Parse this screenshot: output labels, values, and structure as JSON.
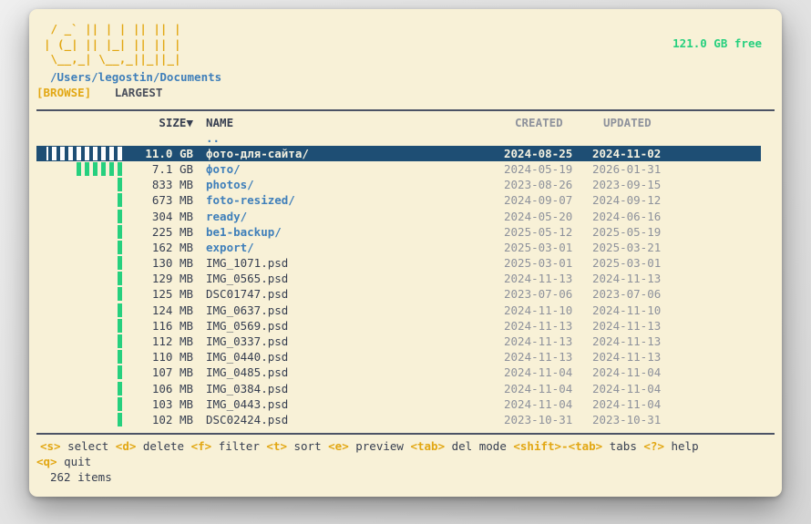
{
  "colors": {
    "window_background": "#f8f1d7",
    "accent_gold": "#e2a713",
    "directory_blue": "#3f7fba",
    "bar_green": "#26d07e",
    "selection_navy": "#1e4e74",
    "text_dark": "#373f51",
    "date_gray": "#8e929c"
  },
  "header": {
    "logo_lines": [
      " / _` || | | || || |",
      "| (_| || |_| || || |",
      " \\__,_| \\__,_||_||_|"
    ],
    "free_space": "121.0 GB free",
    "path": "/Users/legostin/Documents",
    "tabs": [
      {
        "label": "[BROWSE]",
        "active": true
      },
      {
        "label": "LARGEST",
        "active": false
      }
    ]
  },
  "table": {
    "columns": {
      "size": "SIZE▼",
      "name": "NAME",
      "created": "CREATED",
      "updated": "UPDATED"
    },
    "parent_row": "..",
    "max_size_mb": 11264,
    "rows": [
      {
        "size": "11.0 GB",
        "size_mb": 11264,
        "name": "фото-для-сайта/",
        "is_dir": true,
        "created": "2024-08-25",
        "updated": "2024-11-02",
        "selected": true
      },
      {
        "size": "7.1 GB",
        "size_mb": 7270,
        "name": "фото/",
        "is_dir": true,
        "created": "2024-05-19",
        "updated": "2026-01-31",
        "selected": false
      },
      {
        "size": "833 MB",
        "size_mb": 833,
        "name": "photos/",
        "is_dir": true,
        "created": "2023-08-26",
        "updated": "2023-09-15",
        "selected": false
      },
      {
        "size": "673 MB",
        "size_mb": 673,
        "name": "foto-resized/",
        "is_dir": true,
        "created": "2024-09-07",
        "updated": "2024-09-12",
        "selected": false
      },
      {
        "size": "304 MB",
        "size_mb": 304,
        "name": "ready/",
        "is_dir": true,
        "created": "2024-05-20",
        "updated": "2024-06-16",
        "selected": false
      },
      {
        "size": "225 MB",
        "size_mb": 225,
        "name": "be1-backup/",
        "is_dir": true,
        "created": "2025-05-12",
        "updated": "2025-05-19",
        "selected": false
      },
      {
        "size": "162 MB",
        "size_mb": 162,
        "name": "export/",
        "is_dir": true,
        "created": "2025-03-01",
        "updated": "2025-03-21",
        "selected": false
      },
      {
        "size": "130 MB",
        "size_mb": 130,
        "name": "IMG_1071.psd",
        "is_dir": false,
        "created": "2025-03-01",
        "updated": "2025-03-01",
        "selected": false
      },
      {
        "size": "129 MB",
        "size_mb": 129,
        "name": "IMG_0565.psd",
        "is_dir": false,
        "created": "2024-11-13",
        "updated": "2024-11-13",
        "selected": false
      },
      {
        "size": "125 MB",
        "size_mb": 125,
        "name": "DSC01747.psd",
        "is_dir": false,
        "created": "2023-07-06",
        "updated": "2023-07-06",
        "selected": false
      },
      {
        "size": "124 MB",
        "size_mb": 124,
        "name": "IMG_0637.psd",
        "is_dir": false,
        "created": "2024-11-10",
        "updated": "2024-11-10",
        "selected": false
      },
      {
        "size": "116 MB",
        "size_mb": 116,
        "name": "IMG_0569.psd",
        "is_dir": false,
        "created": "2024-11-13",
        "updated": "2024-11-13",
        "selected": false
      },
      {
        "size": "112 MB",
        "size_mb": 112,
        "name": "IMG_0337.psd",
        "is_dir": false,
        "created": "2024-11-13",
        "updated": "2024-11-13",
        "selected": false
      },
      {
        "size": "110 MB",
        "size_mb": 110,
        "name": "IMG_0440.psd",
        "is_dir": false,
        "created": "2024-11-13",
        "updated": "2024-11-13",
        "selected": false
      },
      {
        "size": "107 MB",
        "size_mb": 107,
        "name": "IMG_0485.psd",
        "is_dir": false,
        "created": "2024-11-04",
        "updated": "2024-11-04",
        "selected": false
      },
      {
        "size": "106 MB",
        "size_mb": 106,
        "name": "IMG_0384.psd",
        "is_dir": false,
        "created": "2024-11-04",
        "updated": "2024-11-04",
        "selected": false
      },
      {
        "size": "103 MB",
        "size_mb": 103,
        "name": "IMG_0443.psd",
        "is_dir": false,
        "created": "2024-11-04",
        "updated": "2024-11-04",
        "selected": false
      },
      {
        "size": "102 MB",
        "size_mb": 102,
        "name": "DSC02424.psd",
        "is_dir": false,
        "created": "2023-10-31",
        "updated": "2023-10-31",
        "selected": false
      }
    ]
  },
  "footer": {
    "hints_line1": [
      {
        "key": "<s>",
        "label": "select"
      },
      {
        "key": "<d>",
        "label": "delete"
      },
      {
        "key": "<f>",
        "label": "filter"
      },
      {
        "key": "<t>",
        "label": "sort"
      },
      {
        "key": "<e>",
        "label": "preview"
      },
      {
        "key": "<tab>",
        "label": "del mode"
      },
      {
        "key": "<shift>-<tab>",
        "label": "tabs"
      },
      {
        "key": "<?>",
        "label": "help"
      }
    ],
    "hints_line2": [
      {
        "key": "<q>",
        "label": "quit"
      }
    ],
    "items_count": "262 items"
  }
}
